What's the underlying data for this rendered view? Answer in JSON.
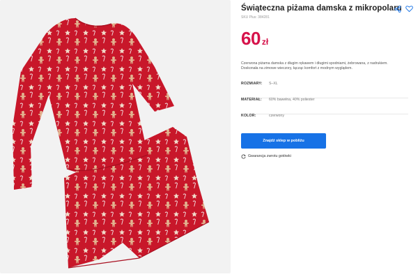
{
  "product": {
    "title": "Świąteczna piżama damska z mikropolaru",
    "sku": "SKU Plus: 384281",
    "price": {
      "amount": "60",
      "currency": "zł"
    },
    "description": "Czerwona piżama damska z długim rękawem i długimi spodniami, żebrowana, z nadrukiem. Doskonała na zimowe wieczory, łącząc komfort z modnym wyglądem.",
    "image_alt": "Red gingerbread print women's Christmas pajama set"
  },
  "attributes": [
    {
      "label": "ROZMIARY:",
      "value": "S–XL"
    },
    {
      "label": "MATERIAŁ:",
      "value": "60% bawełna, 40% poliester"
    },
    {
      "label": "KOLOR:",
      "value": "czerwony"
    }
  ],
  "actions": {
    "find_store": "Znajdź sklep w pobliżu",
    "guarantee": "Gwarancja zwrotu gotówki"
  },
  "icons": [
    "share-icon",
    "heart-icon",
    "refresh-icon"
  ],
  "colors": {
    "price": "#d6124a",
    "cta": "#1772e6",
    "garment": "#c8172a"
  }
}
